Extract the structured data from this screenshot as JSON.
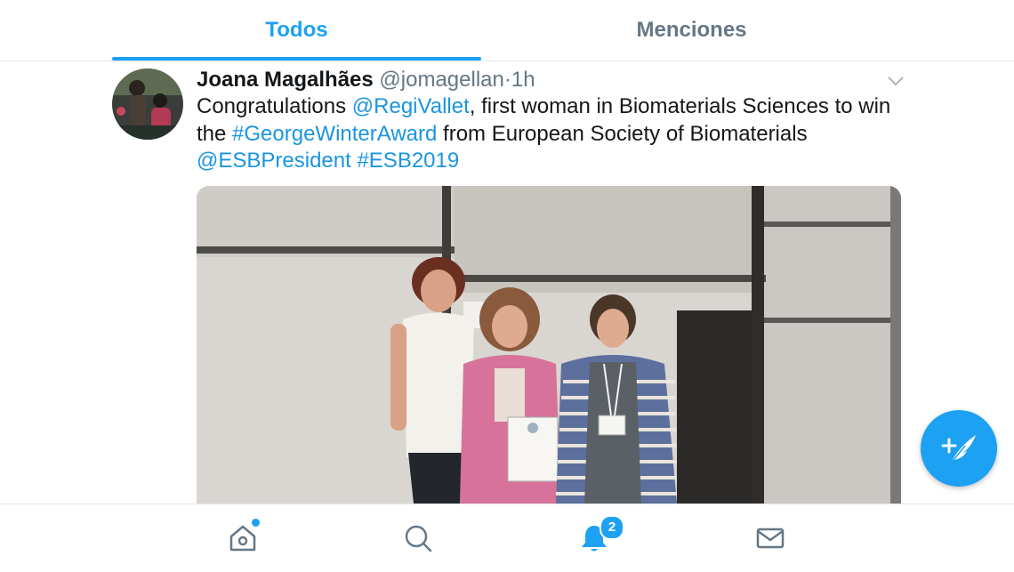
{
  "tabs": {
    "all": "Todos",
    "mentions": "Menciones"
  },
  "tweet": {
    "display_name": "Joana Magalhães",
    "handle": "@jomagellan",
    "separator": "·",
    "time": "1h",
    "text": {
      "t1": "Congratulations ",
      "mention1": "@RegiVallet",
      "t2": ", first woman in Biomaterials Sciences to win the ",
      "hashtag1": "#GeorgeWinterAward",
      "t3": " from European Society of Biomaterials ",
      "mention2": "@ESBPresident",
      "t4": " ",
      "hashtag2": "#ESB2019"
    }
  },
  "bottom_nav": {
    "notifications_badge": "2",
    "items": [
      "home-icon",
      "search-icon",
      "bell-icon",
      "mail-icon"
    ]
  },
  "fab": {
    "icon": "compose-tweet-icon"
  },
  "colors": {
    "accent": "#1da1f2",
    "link": "#1b95e0",
    "secondary_text": "#657786",
    "primary_text": "#14171a"
  }
}
